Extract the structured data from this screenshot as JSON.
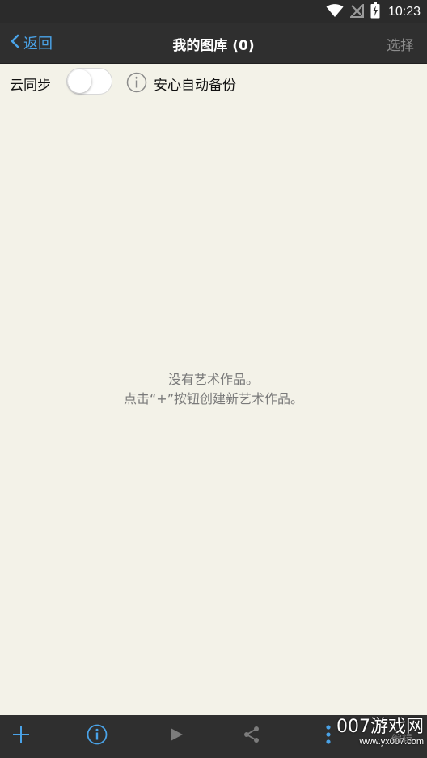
{
  "status_bar": {
    "time": "10:23",
    "icons": [
      "wifi-icon",
      "no-signal-icon",
      "battery-charging-icon"
    ]
  },
  "nav": {
    "back_label": "返回",
    "title": "我的图库 (0)",
    "select_label": "选择"
  },
  "sync": {
    "label": "云同步",
    "enabled": false,
    "backup_label": "安心自动备份"
  },
  "empty_state": {
    "line1": "没有艺术作品。",
    "line2": "点击“+”按钮创建新艺术作品。"
  },
  "toolbar": {
    "items": [
      "add-icon",
      "info-icon",
      "play-icon",
      "share-icon",
      "more-vertical-icon"
    ]
  },
  "watermark": {
    "top": "007游戏网",
    "bottom": "www.yx007.com",
    "behind_text": "编辑"
  },
  "colors": {
    "accent": "#4aa3e8",
    "nav_bg": "#2f2f2f",
    "content_bg": "#f3f2e8",
    "muted_text": "#7a7a7a"
  }
}
